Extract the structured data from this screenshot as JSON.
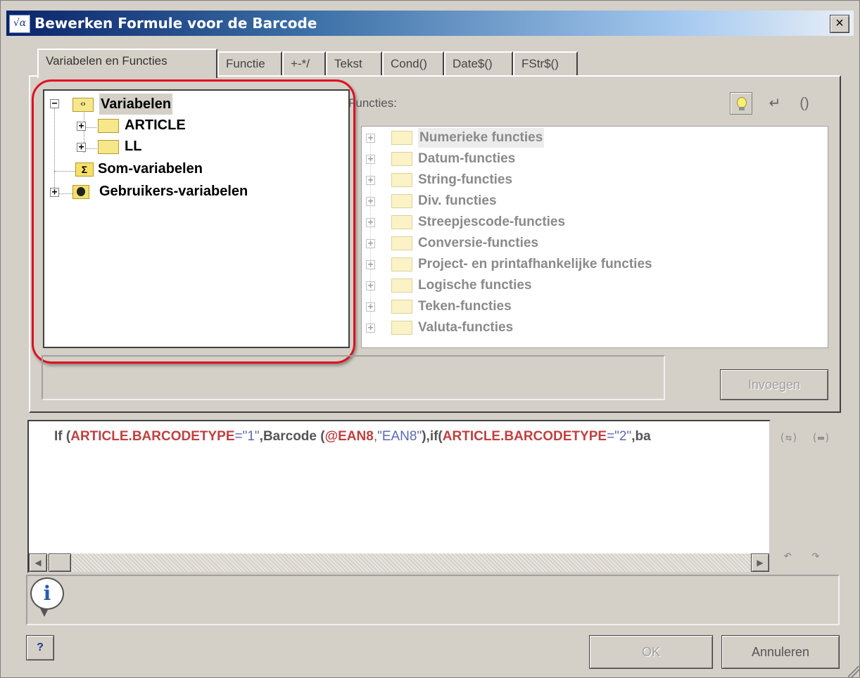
{
  "window": {
    "title": "Bewerken Formule voor de Barcode",
    "close_glyph": "×",
    "icon": "formula-sqrt-icon"
  },
  "tabs": [
    {
      "label": "Variabelen en Functies",
      "active": true
    },
    {
      "label": "Functie",
      "active": false
    },
    {
      "label": "+-*/",
      "active": false
    },
    {
      "label": "Tekst",
      "active": false
    },
    {
      "label": "Cond()",
      "active": false
    },
    {
      "label": "Date$()",
      "active": false
    },
    {
      "label": "FStr$()",
      "active": false
    }
  ],
  "variables_tree": {
    "root": {
      "label": "Variabelen",
      "expander": "−",
      "icon": "variables-icon"
    },
    "children": [
      {
        "label": "ARTICLE",
        "expander": "+",
        "icon": "folder-icon"
      },
      {
        "label": "LL",
        "expander": "+",
        "icon": "folder-icon"
      }
    ],
    "sum_variables": {
      "label": "Som-variabelen",
      "icon": "sigma-icon"
    },
    "user_variables": {
      "label": "Gebruikers-variabelen",
      "expander": "+",
      "icon": "user-variables-icon"
    },
    "highlight_color": "#e01020"
  },
  "functions": {
    "label": "Functies:",
    "items": [
      "Numerieke functies",
      "Datum-functies",
      "String-functies",
      "Div. functies",
      "Streepjescode-functies",
      "Conversie-functies",
      "Project- en printafhankelijke functies",
      "Logische functies",
      "Teken-functies",
      "Valuta-functies"
    ],
    "toolbar": {
      "bulb_icon": "lightbulb-icon",
      "return_glyph": "↵",
      "parens_glyph": "()"
    }
  },
  "insert_button": "Invoegen",
  "formula": {
    "segments": [
      {
        "text": "If (",
        "style": "plain"
      },
      {
        "text": "ARTICLE.BARCODETYPE",
        "style": "red"
      },
      {
        "text": "=\"1\"",
        "style": "blue"
      },
      {
        "text": ",Barcode (",
        "style": "plain"
      },
      {
        "text": "@EAN8",
        "style": "red"
      },
      {
        "text": ",\"EAN8\"",
        "style": "blue"
      },
      {
        "text": "),if(",
        "style": "plain"
      },
      {
        "text": "ARTICLE.BARCODETYPE",
        "style": "red"
      },
      {
        "text": "=\"2\"",
        "style": "blue"
      },
      {
        "text": ",ba",
        "style": "plain"
      }
    ],
    "side_icons": {
      "wrap": "(⇆)",
      "keyboard": "(▬)",
      "undo": "↶",
      "redo": "↷"
    },
    "scroll_left": "◀",
    "scroll_right": "▶"
  },
  "info": {
    "icon_glyph": "i"
  },
  "buttons": {
    "help": "?",
    "ok": "OK",
    "cancel": "Annuleren"
  },
  "colors": {
    "title_start": "#0a246a",
    "formula_keyword": "#c04040",
    "formula_string": "#5a6ab0",
    "disabled_text": "#a0a0a0"
  }
}
